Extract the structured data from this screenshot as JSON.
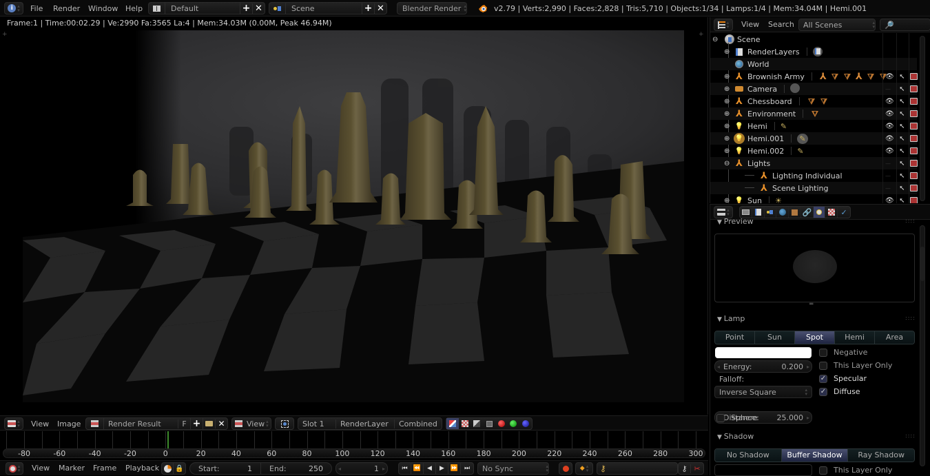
{
  "topbar": {
    "menus": [
      "File",
      "Render",
      "Window",
      "Help"
    ],
    "screen_layout": "Default",
    "scene": "Scene",
    "render_engine": "Blender Render",
    "stats": "v2.79 | Verts:2,990 | Faces:2,828 | Tris:5,710 | Objects:1/34 | Lamps:1/4 | Mem:34.04M | Hemi.001"
  },
  "viewport": {
    "render_info": "Frame:1 | Time:00:02.29 | Ve:2990 Fa:3565 La:4 | Mem:34.03M (0.00M, Peak 46.94M)",
    "image_alt": "Rendered chess scene with dark marble board and brownish pieces casting shadows on a wall"
  },
  "image_editor_header": {
    "menus": [
      "View",
      "Image"
    ],
    "image_name": "Render Result",
    "fake_user": "F",
    "view_dropdown": "View",
    "slot": "Slot 1",
    "render_layer": "RenderLayer",
    "pass": "Combined"
  },
  "timeline": {
    "ticks": [
      -80,
      -60,
      -40,
      -20,
      0,
      20,
      40,
      60,
      80,
      100,
      120,
      140,
      160,
      180,
      200,
      220,
      240,
      260,
      280,
      300
    ],
    "current_frame_marker": 0,
    "menus": [
      "View",
      "Marker",
      "Frame",
      "Playback"
    ],
    "start_label": "Start:",
    "start_value": "1",
    "end_label": "End:",
    "end_value": "250",
    "current_frame": "1",
    "sync": "No Sync"
  },
  "outliner": {
    "menus": [
      "View",
      "Search"
    ],
    "filter": "All Scenes",
    "root": "Scene",
    "items": [
      {
        "name": "RenderLayers",
        "indent": 1,
        "expand": "+",
        "type": "renderlayers",
        "visible": null
      },
      {
        "name": "World",
        "indent": 1,
        "expand": "",
        "type": "world",
        "visible": null
      },
      {
        "name": "Brownish Army",
        "indent": 1,
        "expand": "+",
        "type": "empty",
        "children_icons": [
          "empty",
          "mesh",
          "mesh",
          "empty",
          "mesh",
          "mesh"
        ],
        "visible": true
      },
      {
        "name": "Camera",
        "indent": 1,
        "expand": "+",
        "type": "camera",
        "visible": false
      },
      {
        "name": "Chessboard",
        "indent": 1,
        "expand": "+",
        "type": "empty",
        "children_icons": [
          "mesh",
          "mesh"
        ],
        "visible": true
      },
      {
        "name": "Environment",
        "indent": 1,
        "expand": "+",
        "type": "empty",
        "children_icons": [
          "mesh"
        ],
        "visible": true
      },
      {
        "name": "Hemi",
        "indent": 1,
        "expand": "+",
        "type": "lamp",
        "visible": true
      },
      {
        "name": "Hemi.001",
        "indent": 1,
        "expand": "+",
        "type": "lamp",
        "selected": true,
        "visible": true
      },
      {
        "name": "Hemi.002",
        "indent": 1,
        "expand": "+",
        "type": "lamp",
        "visible": true
      },
      {
        "name": "Lights",
        "indent": 1,
        "expand": "-",
        "type": "empty",
        "visible": false
      },
      {
        "name": "Lighting Individual",
        "indent": 2,
        "expand": "",
        "type": "empty",
        "visible": false
      },
      {
        "name": "Scene Lighting",
        "indent": 2,
        "expand": "",
        "type": "empty",
        "visible": false
      },
      {
        "name": "Sun",
        "indent": 1,
        "expand": "+",
        "type": "lamp",
        "visible": true
      }
    ]
  },
  "properties": {
    "tabs": [
      "render",
      "render-layers",
      "scene",
      "world",
      "object",
      "constraints",
      "lamp-data",
      "texture",
      "physics"
    ],
    "active_tab": "lamp-data",
    "preview_title": "Preview",
    "lamp": {
      "title": "Lamp",
      "types": [
        "Point",
        "Sun",
        "Spot",
        "Hemi",
        "Area"
      ],
      "active_type": "Spot",
      "color": "#ffffff",
      "energy_label": "Energy:",
      "energy": "0.200",
      "falloff_label": "Falloff:",
      "falloff": "Inverse Square",
      "distance_label": "Distance:",
      "distance": "25.000",
      "sphere_label": "Sphere",
      "sphere": false,
      "negative_label": "Negative",
      "negative": false,
      "this_layer_only_label": "This Layer Only",
      "this_layer_only": false,
      "specular_label": "Specular",
      "specular": true,
      "diffuse_label": "Diffuse",
      "diffuse": true
    },
    "shadow": {
      "title": "Shadow",
      "types": [
        "No Shadow",
        "Buffer Shadow",
        "Ray Shadow"
      ],
      "active_type": "Buffer Shadow",
      "this_layer_only_label": "This Layer Only",
      "this_layer_only": false
    }
  },
  "colors": {
    "accent_orange": "#e87d0d",
    "selected_tab": "#3a4064",
    "frame_marker": "#3d8a2c"
  }
}
